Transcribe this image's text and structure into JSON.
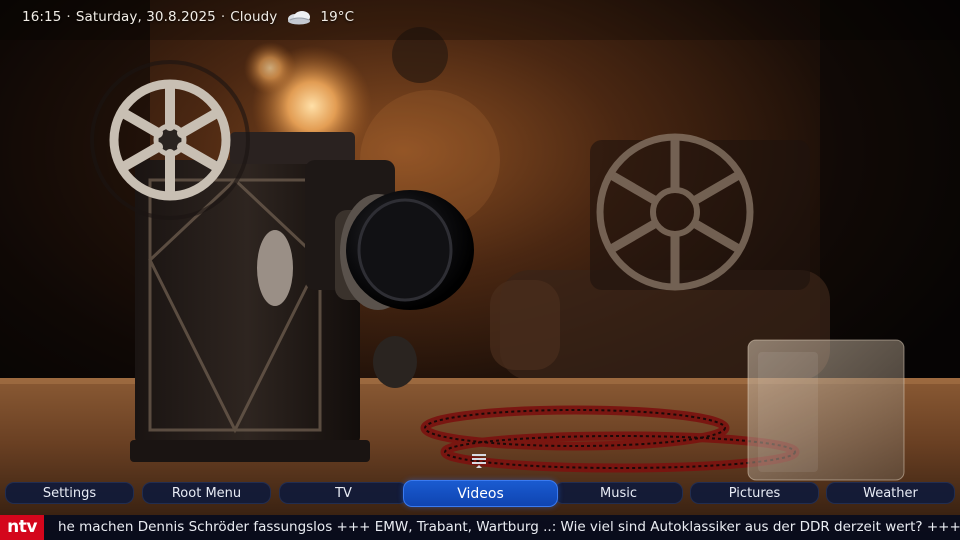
{
  "status": {
    "time": "16:15",
    "date": "Saturday, 30.8.2025",
    "condition": "Cloudy",
    "temperature": "19°C",
    "separator": "·",
    "weather_icon": "cloudy-icon"
  },
  "menu": {
    "indicator_icon": "hamburger-menu-icon",
    "items": [
      {
        "label": "Settings"
      },
      {
        "label": "Root Menu"
      },
      {
        "label": "TV"
      },
      {
        "label": "Videos"
      },
      {
        "label": "Music"
      },
      {
        "label": "Pictures"
      },
      {
        "label": "Weather"
      }
    ],
    "selected": "Videos"
  },
  "ticker": {
    "logo": "ntv",
    "text": "he machen Dennis Schröder fassungslos +++ EMW, Trabant, Wartburg ..: Wie viel sind Autoklassiker aus der DDR derzeit wert? +++ Trauer"
  },
  "colors": {
    "menu_bg": "#101a3a",
    "menu_active": "#1552c4",
    "ticker_bg": "#040a1e",
    "logo_red": "#d4061c"
  }
}
